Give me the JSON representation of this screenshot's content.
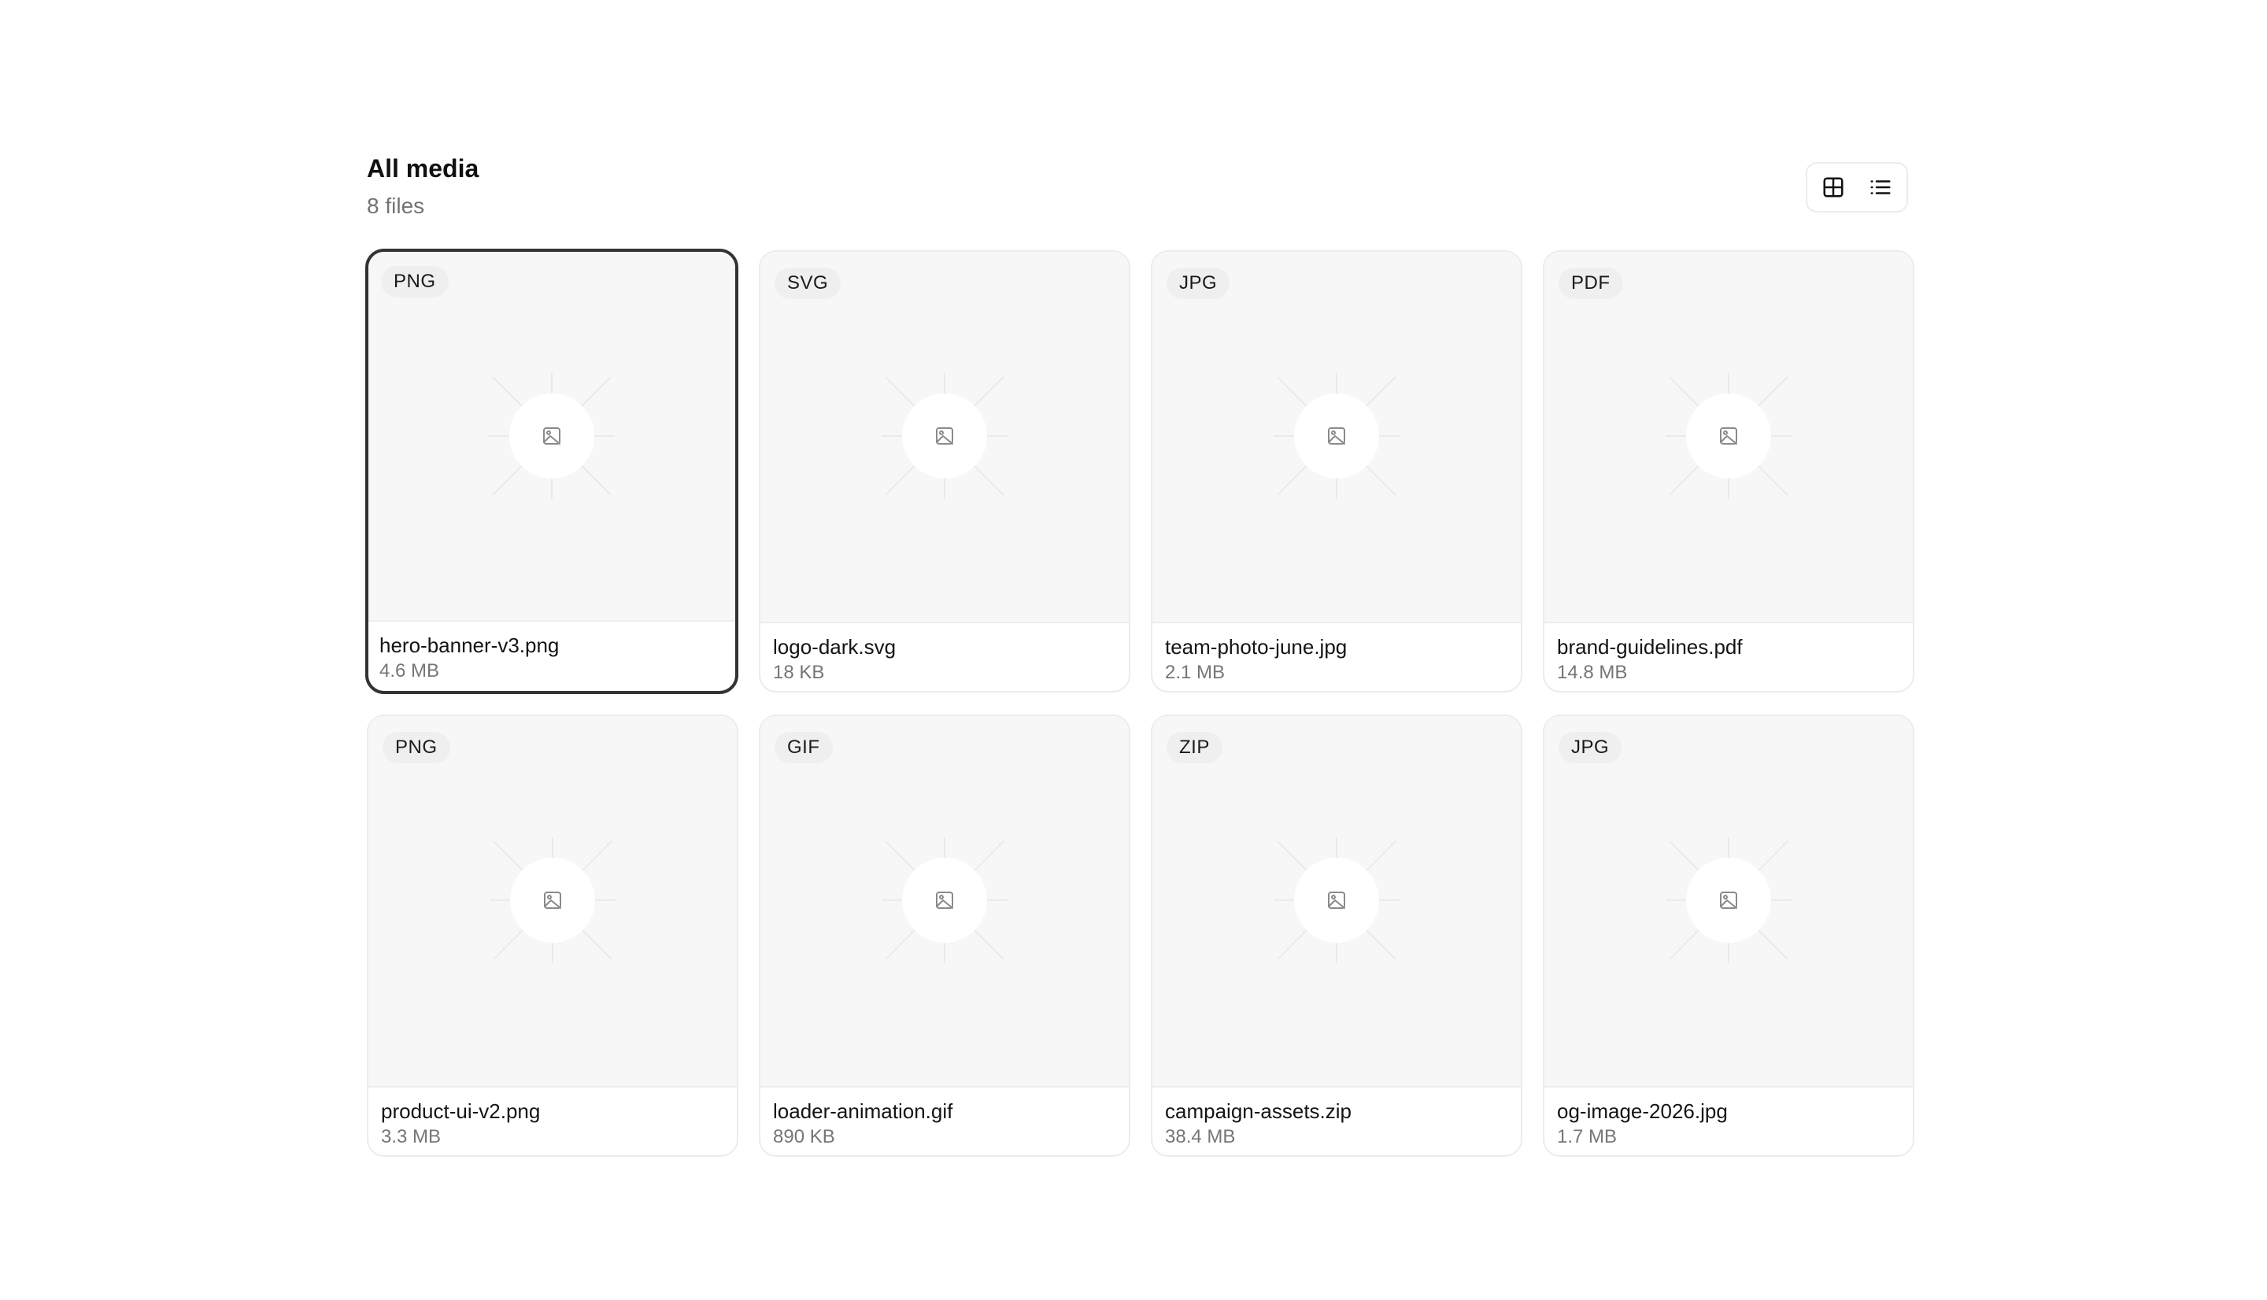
{
  "header": {
    "title": "All media",
    "file_count": "8 files"
  },
  "view_toggle": {
    "options": [
      "grid-icon",
      "list-icon"
    ],
    "active": "grid"
  },
  "colors": {
    "selected_border": "#333333",
    "card_border": "#ececec",
    "thumb_bg": "#f7f7f7",
    "muted_text": "#737373"
  },
  "files": [
    {
      "type": "PNG",
      "name": "hero-banner-v3.png",
      "size": "4.6 MB",
      "selected": true
    },
    {
      "type": "SVG",
      "name": "logo-dark.svg",
      "size": "18 KB",
      "selected": false
    },
    {
      "type": "JPG",
      "name": "team-photo-june.jpg",
      "size": "2.1 MB",
      "selected": false
    },
    {
      "type": "PDF",
      "name": "brand-guidelines.pdf",
      "size": "14.8 MB",
      "selected": false
    },
    {
      "type": "PNG",
      "name": "product-ui-v2.png",
      "size": "3.3 MB",
      "selected": false
    },
    {
      "type": "GIF",
      "name": "loader-animation.gif",
      "size": "890 KB",
      "selected": false
    },
    {
      "type": "ZIP",
      "name": "campaign-assets.zip",
      "size": "38.4 MB",
      "selected": false
    },
    {
      "type": "JPG",
      "name": "og-image-2026.jpg",
      "size": "1.7 MB",
      "selected": false
    }
  ]
}
